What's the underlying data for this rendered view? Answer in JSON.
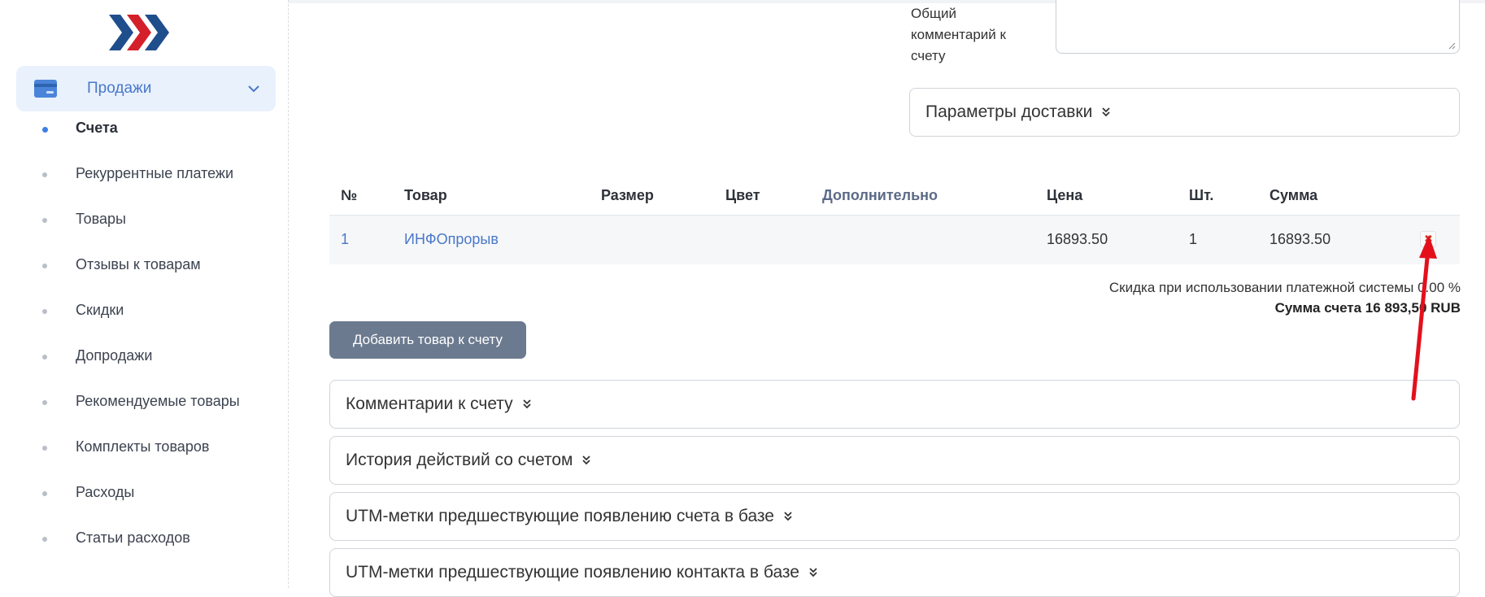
{
  "sidebar": {
    "section_label": "Продажи",
    "items": [
      {
        "label": "Счета",
        "active": true
      },
      {
        "label": "Рекуррентные платежи",
        "active": false
      },
      {
        "label": "Товары",
        "active": false
      },
      {
        "label": "Отзывы к товарам",
        "active": false
      },
      {
        "label": "Скидки",
        "active": false
      },
      {
        "label": "Допродажи",
        "active": false
      },
      {
        "label": "Рекомендуемые товары",
        "active": false
      },
      {
        "label": "Комплекты товаров",
        "active": false
      },
      {
        "label": "Расходы",
        "active": false
      },
      {
        "label": "Статьи расходов",
        "active": false
      }
    ]
  },
  "invoice": {
    "comment_label": "Общий комментарий к счету",
    "comment_value": "",
    "delivery_params": "Параметры доставки",
    "table": {
      "headers": {
        "num": "№",
        "product": "Товар",
        "size": "Размер",
        "color": "Цвет",
        "extra": "Дополнительно",
        "price": "Цена",
        "qty": "Шт.",
        "sum": "Сумма"
      },
      "rows": [
        {
          "num": "1",
          "product": "ИНФОпрорыв",
          "size": "",
          "color": "",
          "extra": "",
          "price": "16893.50",
          "qty": "1",
          "sum": "16893.50"
        }
      ]
    },
    "discount_text": "Скидка при использовании платежной системы 0.00 %",
    "total_text": "Сумма счета 16 893,50 RUB",
    "add_button": "Добавить товар к счету",
    "sections": {
      "comments": "Комментарии к счету",
      "history": "История действий со счетом",
      "utm_invoice": "UTM-метки предшествующие появлению счета в базе",
      "utm_contact": "UTM-метки предшествующие появлению контакта в базе"
    }
  },
  "colors": {
    "accent": "#4a78c9",
    "section_bg": "#e9f1fd",
    "button": "#6b7a8f",
    "annotation_arrow": "#e3101c"
  }
}
